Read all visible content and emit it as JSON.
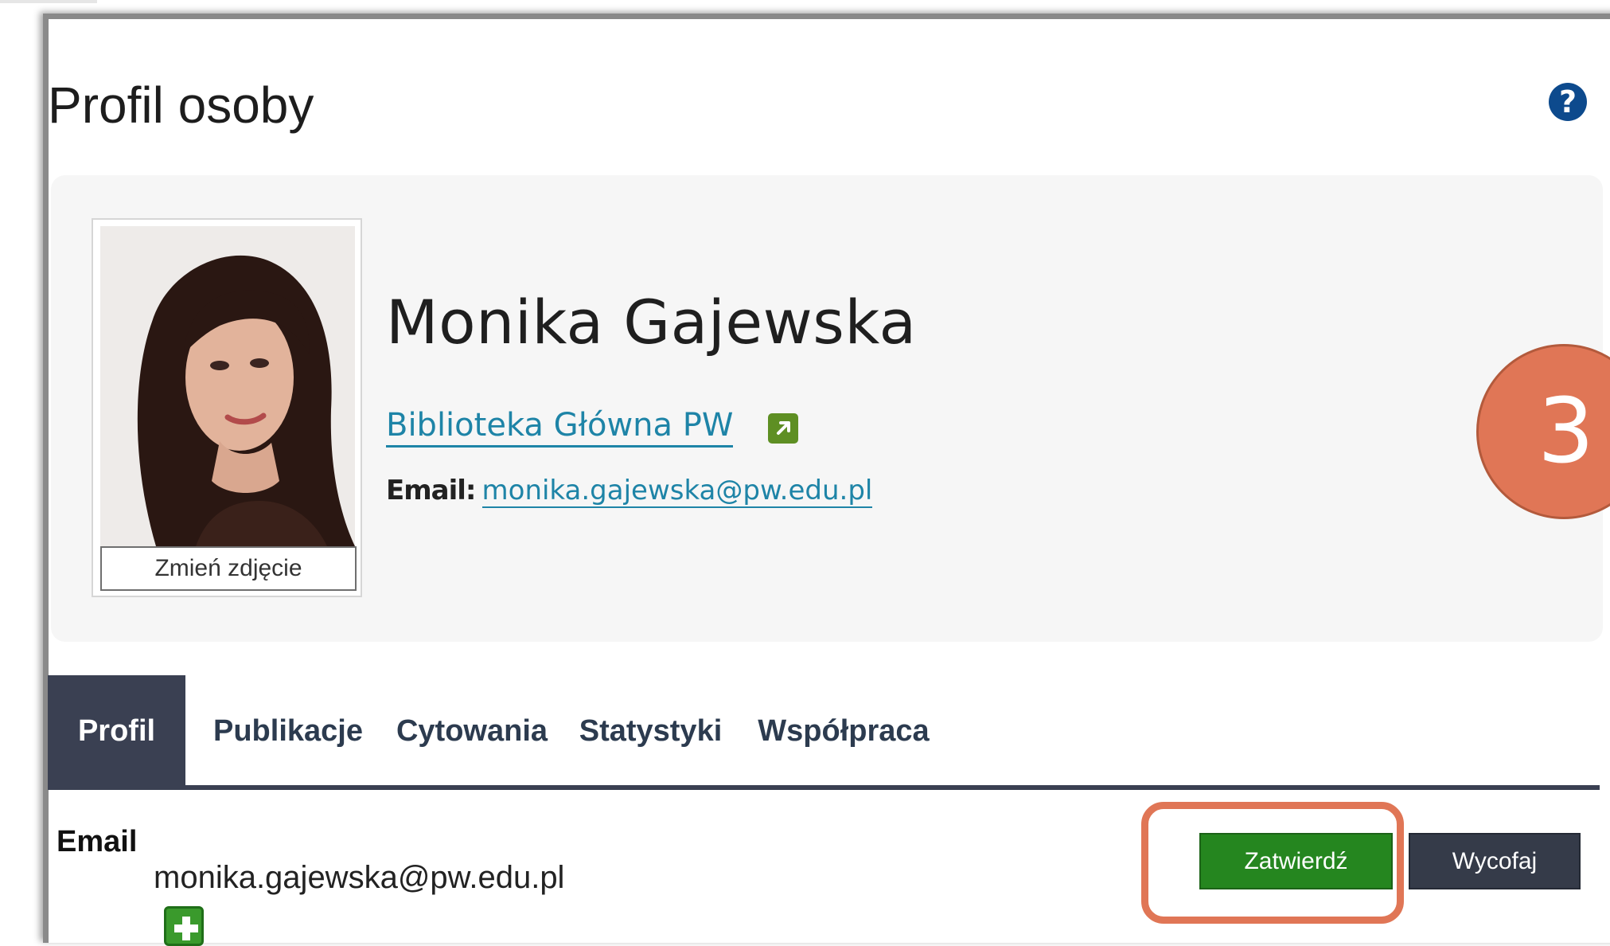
{
  "header": {
    "title": "Profil osoby",
    "help_icon": "help-icon",
    "help_symbol": "?"
  },
  "profile": {
    "name": "Monika Gajewska",
    "unit_link": "Biblioteka Główna PW",
    "unit_link_icon": "external-link-icon",
    "email_label": "Email:",
    "email": "monika.gajewska@pw.edu.pl",
    "change_photo_label": "Zmień zdjęcie"
  },
  "callout": {
    "step_number": "3",
    "color": "#e07656"
  },
  "tabs": [
    {
      "label": "Profil",
      "active": true
    },
    {
      "label": "Publikacje",
      "active": false
    },
    {
      "label": "Cytowania",
      "active": false
    },
    {
      "label": "Statystyki",
      "active": false
    },
    {
      "label": "Współpraca",
      "active": false
    }
  ],
  "email_section": {
    "label": "Email",
    "value": "monika.gajewska@pw.edu.pl",
    "add_icon": "add-icon"
  },
  "actions": {
    "confirm_label": "Zatwierdź",
    "withdraw_label": "Wycofaj"
  },
  "colors": {
    "link": "#1e84a7",
    "tab_active": "#3a4052",
    "confirm": "#25861f",
    "withdraw": "#353b49"
  }
}
